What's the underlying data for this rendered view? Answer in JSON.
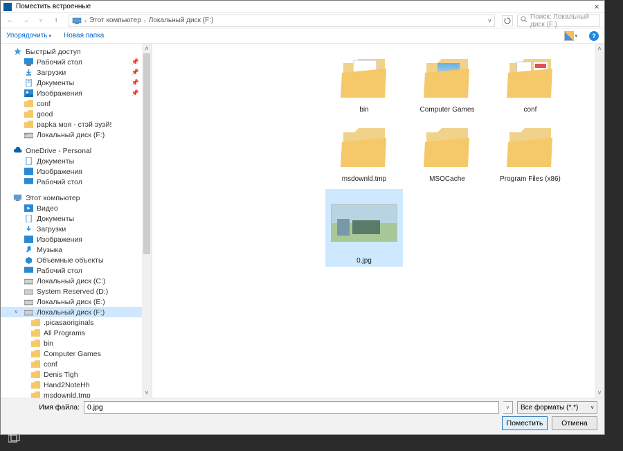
{
  "title": "Поместить встроенные",
  "breadcrumb": {
    "pc": "Этот компьютер",
    "drive": "Локальный диск (F:)"
  },
  "search": {
    "placeholder": "Поиск: Локальный диск (F:)"
  },
  "toolbar": {
    "organize": "Упорядочить",
    "newfolder": "Новая папка"
  },
  "tree": {
    "quick": "Быстрый доступ",
    "quick_items": [
      "Рабочий стол",
      "Загрузки",
      "Документы",
      "Изображения",
      "conf",
      "good",
      "papka моя - стэй эуэй!",
      "Локальный диск (F:)"
    ],
    "onedrive": "OneDrive - Personal",
    "onedrive_items": [
      "Документы",
      "Изображения",
      "Рабочий стол"
    ],
    "thispc": "Этот компьютер",
    "thispc_items": [
      "Видео",
      "Документы",
      "Загрузки",
      "Изображения",
      "Музыка",
      "Объемные объекты",
      "Рабочий стол",
      "Локальный диск (C:)",
      "System Reserved (D:)",
      "Локальный диск (E:)",
      "Локальный диск (F:)"
    ],
    "f_items": [
      ".picasaoriginals",
      "All Programs",
      "bin",
      "Computer Games",
      "conf",
      "Denis Tigh",
      "Hand2NoteHh",
      "msdownld.tmp"
    ]
  },
  "files": {
    "items": [
      {
        "name": "bin",
        "type": "folder-doc"
      },
      {
        "name": "Computer Games",
        "type": "folder-img"
      },
      {
        "name": "conf",
        "type": "folder-mix"
      },
      {
        "name": "msdownld.tmp",
        "type": "folder-empty"
      },
      {
        "name": "MSOCache",
        "type": "folder-empty"
      },
      {
        "name": "Program Files (x86)",
        "type": "folder-empty"
      },
      {
        "name": "0.jpg",
        "type": "image",
        "selected": true
      }
    ]
  },
  "bottom": {
    "filename_label": "Имя файла:",
    "filename_value": "0.jpg",
    "filter": "Все форматы (*.*)",
    "ok": "Поместить",
    "cancel": "Отмена"
  }
}
